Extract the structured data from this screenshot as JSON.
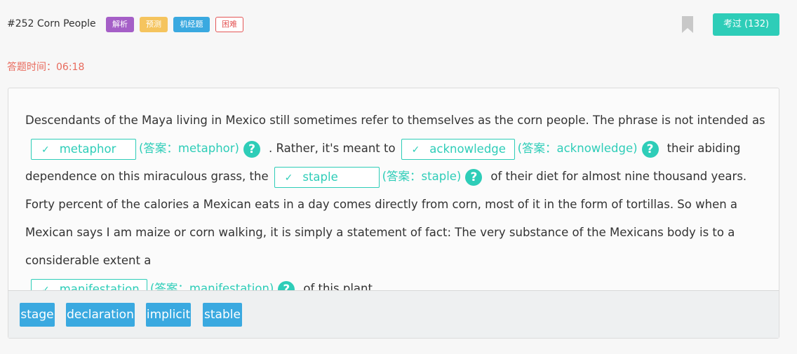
{
  "header": {
    "question_title": "#252 Corn People",
    "tags": {
      "analysis": "解析",
      "predict": "预测",
      "jijing": "机经题",
      "hard": "困难"
    },
    "bookmark_icon": "bookmark-icon",
    "exam_button": "考过 (132)"
  },
  "timer": {
    "text": "答题时间：06:18"
  },
  "passage": {
    "p1": "Descendants of the Maya living in Mexico still sometimes refer to themselves as the corn people. The phrase is not intended as",
    "blank1": "metaphor",
    "answer1": "(答案：metaphor)",
    "p2": ". Rather, it's meant to",
    "blank2": "acknowledge",
    "answer2": "(答案：acknowledge)",
    "p3": "their abiding dependence on this miraculous grass, the",
    "blank3": "staple",
    "answer3": "(答案：staple)",
    "p4": "of their diet for almost nine thousand years. Forty percent of the calories a Mexican eats in a day comes directly from corn, most of it in the form of tortillas. So when a Mexican says I am maize or corn walking, it is simply a statement of fact: The very substance of the Mexicans body is to a considerable extent a",
    "blank4": "manifestation",
    "answer4": "(答案：manifestation)",
    "p5": "of this plant.",
    "check_glyph": "✓",
    "help_glyph": "?"
  },
  "options": [
    "stage",
    "declaration",
    "implicit",
    "stable"
  ],
  "colors": {
    "accent": "#2ecdb8",
    "option_blue": "#3aa9e0",
    "timer_red": "#e86a5c",
    "tag_purple": "#a55fc7",
    "tag_yellow": "#f5c45e"
  }
}
